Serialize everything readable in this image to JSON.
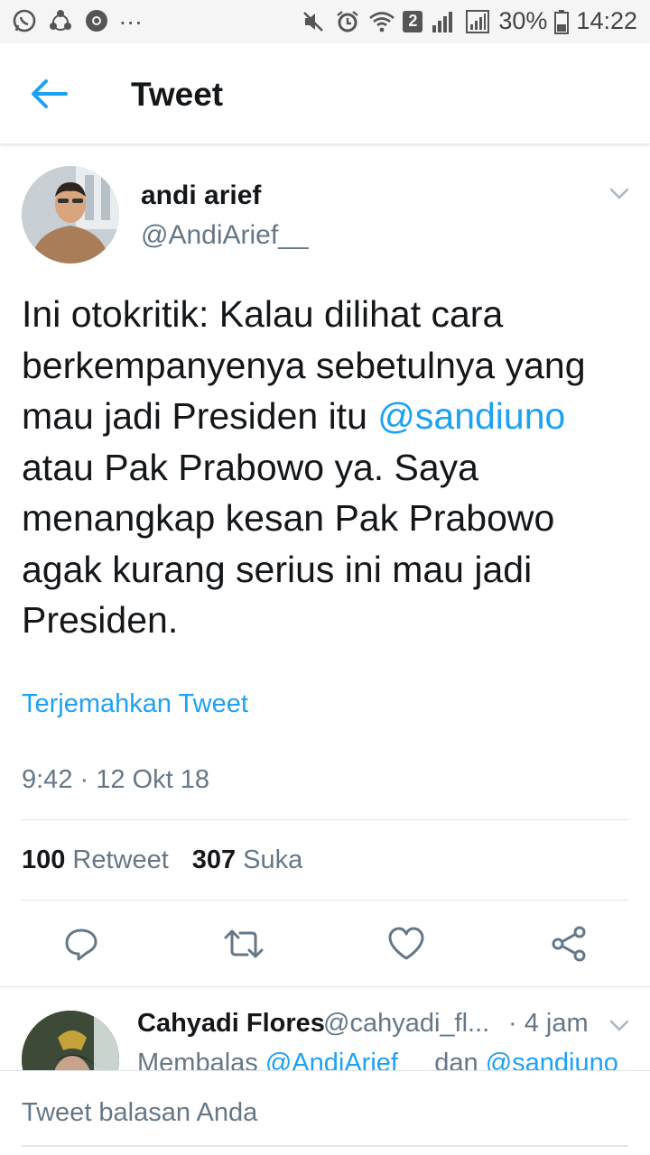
{
  "status_bar": {
    "overflow": "...",
    "sim_badge": "2",
    "battery": "30%",
    "time": "14:22"
  },
  "app_bar": {
    "title": "Tweet"
  },
  "tweet": {
    "author_name": "andi arief",
    "author_handle": "@AndiArief__",
    "text_before": "Ini otokritik: Kalau dilihat cara berkempanyenya sebetulnya yang mau jadi Presiden itu ",
    "mention": "@sandiuno",
    "text_after": " atau Pak Prabowo ya. Saya menangkap kesan Pak Prabowo agak kurang serius ini mau jadi Presiden.",
    "translate_label": "Terjemahkan Tweet",
    "timestamp": "9:42 · 12 Okt 18",
    "retweet_count": "100",
    "retweet_label": "Retweet",
    "like_count": "307",
    "like_label": "Suka"
  },
  "actions": {
    "icons": [
      "reply-icon",
      "retweet-icon",
      "like-icon",
      "share-icon"
    ]
  },
  "reply": {
    "name": "Cahyadi Flores",
    "handle": "@cahyadi_fl...",
    "time": "· 4 jam",
    "replying_prefix": "Membalas",
    "replying_user1": "@AndiArief__",
    "replying_conj": "dan",
    "replying_user2": "@sandiuno"
  },
  "compose": {
    "placeholder": "Tweet balasan Anda"
  },
  "colors": {
    "accent": "#1da1f2",
    "secondary_text": "#657786",
    "primary_text": "#14171a",
    "divider": "#e1e4e8"
  }
}
